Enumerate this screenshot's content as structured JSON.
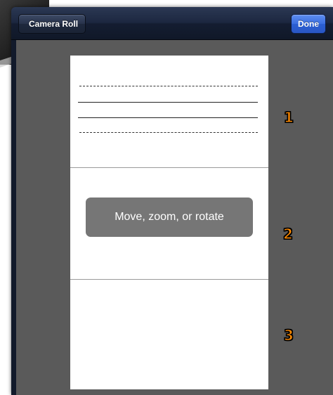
{
  "navbar": {
    "back_label": "Camera Roll",
    "done_label": "Done"
  },
  "overlay": {
    "hint_text": "Move, zoom, or rotate"
  },
  "markers": [
    "1",
    "2",
    "3"
  ],
  "colors": {
    "navbar": "#1c2740",
    "done_button": "#3a6ee0",
    "content_background": "#5a5a5a",
    "paper": "#ffffff",
    "hint_background": "#707070",
    "marker_fill": "#ff8a00"
  }
}
